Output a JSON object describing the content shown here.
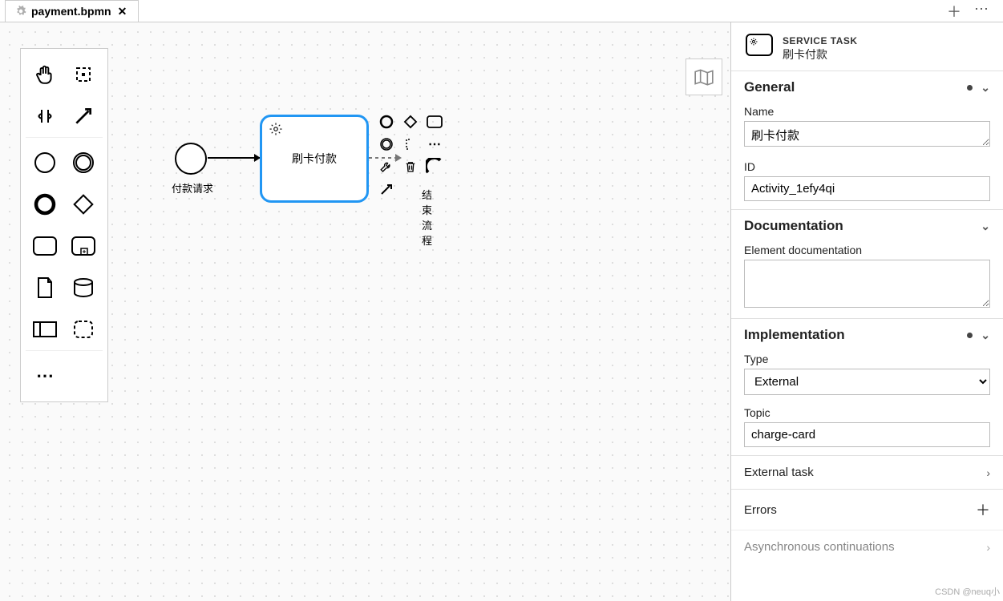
{
  "tab": {
    "filename": "payment.bpmn"
  },
  "diagram": {
    "startEventLabel": "付款请求",
    "taskLabel": "刷卡付款",
    "endLabel": "结束流程"
  },
  "panel": {
    "typeLabel": "SERVICE TASK",
    "typeName": "刷卡付款",
    "sections": {
      "general": {
        "title": "General",
        "nameLabel": "Name",
        "nameValue": "刷卡付款",
        "idLabel": "ID",
        "idValue": "Activity_1efy4qi"
      },
      "documentation": {
        "title": "Documentation",
        "docLabel": "Element documentation",
        "docValue": ""
      },
      "implementation": {
        "title": "Implementation",
        "typeLabel": "Type",
        "typeValue": "External",
        "topicLabel": "Topic",
        "topicValue": "charge-card"
      },
      "externalTask": {
        "title": "External task"
      },
      "errors": {
        "title": "Errors"
      },
      "async": {
        "title": "Asynchronous continuations"
      }
    }
  },
  "watermark": "CSDN @neuq小"
}
